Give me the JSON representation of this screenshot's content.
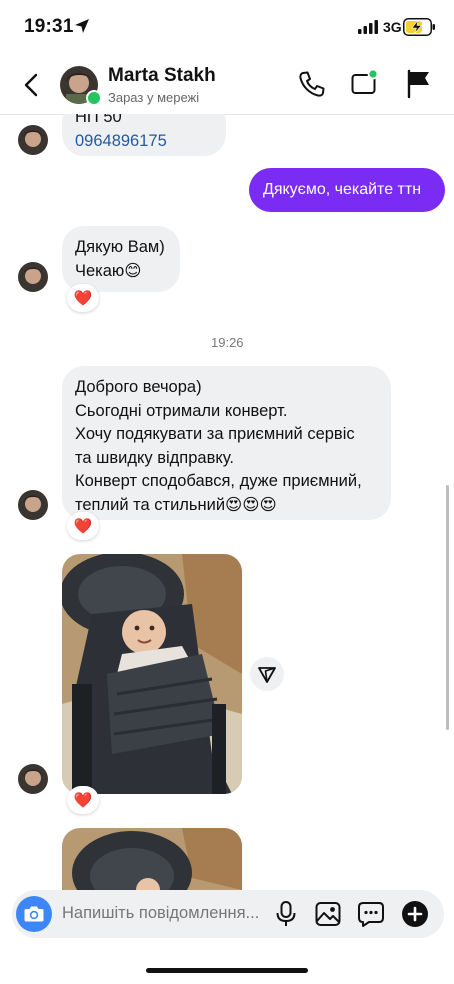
{
  "status_bar": {
    "time": "19:31",
    "network": "3G"
  },
  "header": {
    "contact_name": "Marta Stakh",
    "presence": "Зараз у мережі"
  },
  "messages": {
    "m1_partial": "НП 50",
    "m1_phone": "0964896175",
    "m2_out": "Дякуємо, чекайте ттн",
    "m3_line1": "Дякую Вам)",
    "m3_line2": "Чекаю😊",
    "timestamp": "19:26",
    "m4_line1": "Доброго вечора)",
    "m4_line2": "Сьогодні отримали конверт.",
    "m4_line3": "Хочу подякувати за приємний сервіс",
    "m4_line4": "та швидку відправку.",
    "m4_line5": "Конверт сподобався, дуже приємний,",
    "m4_line6": "теплий та стильний😍😍😍"
  },
  "reactions": {
    "heart": "❤️"
  },
  "composer": {
    "placeholder": "Напишіть повідомлення..."
  },
  "colors": {
    "accent_outgoing": "#7a2cf4",
    "incoming_bubble": "#eff0f2",
    "camera_button": "#3d86f6",
    "online": "#22c55e"
  },
  "icons": [
    "location-arrow-icon",
    "signal-icon",
    "battery-charging-icon",
    "back-chevron-icon",
    "phone-icon",
    "video-call-icon",
    "flag-icon",
    "send-icon",
    "camera-icon",
    "microphone-icon",
    "gallery-icon",
    "sticker-icon",
    "plus-icon"
  ]
}
